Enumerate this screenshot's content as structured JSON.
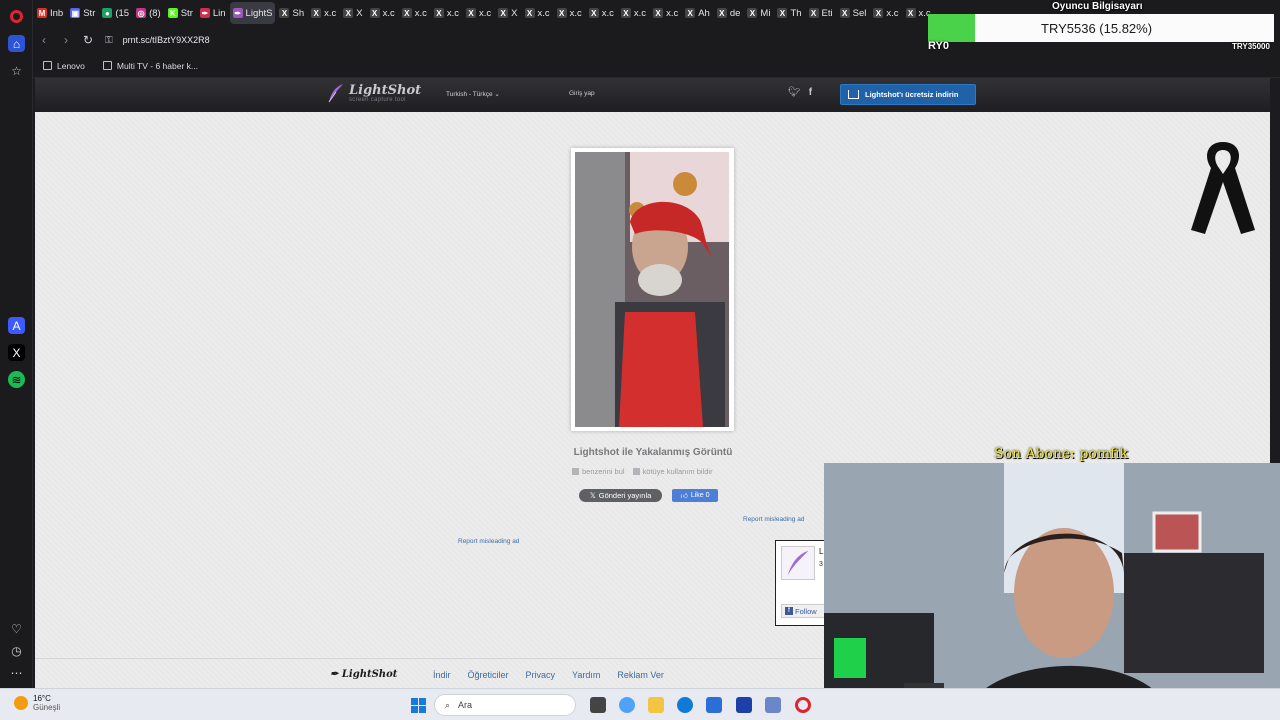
{
  "browser": {
    "tabs": [
      {
        "label": "Inb",
        "color": "#d93025",
        "glyph": "M"
      },
      {
        "label": "Str",
        "color": "#5865f2",
        "glyph": "▣"
      },
      {
        "label": "(15",
        "color": "#1aa260",
        "glyph": "●"
      },
      {
        "label": "(8)",
        "color": "#c13584",
        "glyph": "◎"
      },
      {
        "label": "Str",
        "color": "#53fc18",
        "glyph": "K"
      },
      {
        "label": "Lin",
        "color": "#cf2f4c",
        "glyph": "✒"
      },
      {
        "label": "LightS",
        "color": "#9b59b6",
        "glyph": "✒",
        "active": true
      },
      {
        "label": "Sh",
        "color": "#444",
        "glyph": "X"
      },
      {
        "label": "x.c",
        "color": "#444",
        "glyph": "X"
      },
      {
        "label": "X",
        "color": "#444",
        "glyph": "X"
      },
      {
        "label": "x.c",
        "color": "#444",
        "glyph": "X"
      },
      {
        "label": "x.c",
        "color": "#444",
        "glyph": "X"
      },
      {
        "label": "x.c",
        "color": "#444",
        "glyph": "X"
      },
      {
        "label": "x.c",
        "color": "#444",
        "glyph": "X"
      },
      {
        "label": "X",
        "color": "#444",
        "glyph": "X"
      },
      {
        "label": "x.c",
        "color": "#444",
        "glyph": "X"
      },
      {
        "label": "x.c",
        "color": "#444",
        "glyph": "X"
      },
      {
        "label": "x.c",
        "color": "#444",
        "glyph": "X"
      },
      {
        "label": "x.c",
        "color": "#444",
        "glyph": "X"
      },
      {
        "label": "x.c",
        "color": "#444",
        "glyph": "X"
      },
      {
        "label": "Ah",
        "color": "#444",
        "glyph": "X"
      },
      {
        "label": "de",
        "color": "#444",
        "glyph": "X"
      },
      {
        "label": "Mi",
        "color": "#444",
        "glyph": "X"
      },
      {
        "label": "Th",
        "color": "#444",
        "glyph": "X"
      },
      {
        "label": "Eti",
        "color": "#444",
        "glyph": "X"
      },
      {
        "label": "Sel",
        "color": "#444",
        "glyph": "X"
      },
      {
        "label": "x.c",
        "color": "#444",
        "glyph": "X"
      },
      {
        "label": "x.c",
        "color": "#444",
        "glyph": "X"
      }
    ],
    "url": "prnt.sc/tIBztY9XX2R8",
    "bookmarks": [
      {
        "label": "Lenovo"
      },
      {
        "label": "Multi TV - 6 haber k..."
      }
    ]
  },
  "lightshot": {
    "logo_name": "LightShot",
    "logo_tagline": "screen capture tool",
    "language": "Turkish - Türkçe",
    "login": "Giriş yap",
    "download_button": "Lightshot'ı ücretsiz indirin",
    "caption": "Lightshot ile Yakalanmış Görüntü",
    "find_similar": "benzerini bul",
    "report_abuse": "kötüye kullanım bildir",
    "tweet_button": "Gönderi yayınla",
    "fb_like": "Like 0",
    "report_ad_1": "Report misleading ad",
    "report_ad_2": "Report misleading ad",
    "fb_card_title": "L",
    "fb_card_sub": "3",
    "fb_follow": "Follow",
    "footer_logo": "LightShot",
    "footer_links": [
      "İndir",
      "Öğreticiler",
      "Privacy",
      "Yardım",
      "Reklam Ver"
    ]
  },
  "overlay": {
    "crypto_title": "Oyuncu Bilgisayarı",
    "crypto_value": "TRY5536 (15.82%)",
    "crypto_left": "RY0",
    "crypto_right": "TRY35000",
    "crypto_progress": 0.1582,
    "subscriber": "Son Abone: pomfik"
  },
  "taskbar": {
    "weather_temp": "16°C",
    "weather_desc": "Güneşli",
    "search_placeholder": "Ara"
  }
}
